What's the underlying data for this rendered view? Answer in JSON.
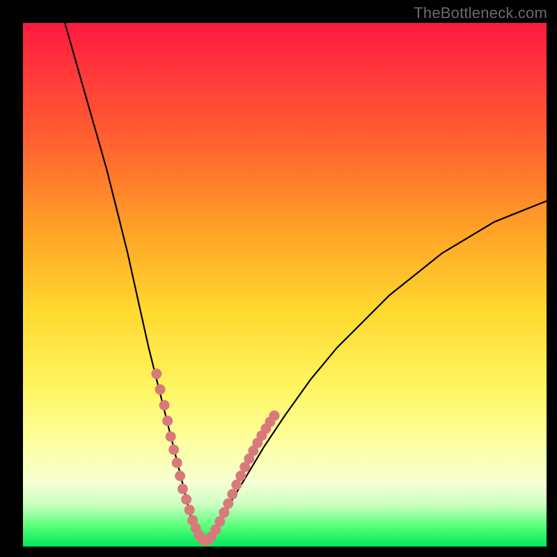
{
  "watermark": "TheBottleneck.com",
  "colors": {
    "background": "#000000",
    "curve": "#000000",
    "dots": "#d87a7a",
    "gradient_stops": [
      "#ff1a3e",
      "#ff3a3a",
      "#ff6a2e",
      "#ffa427",
      "#ffd92e",
      "#fff663",
      "#fdff9e",
      "#f6ffd4",
      "#caffc0",
      "#5bff7a",
      "#00e85c"
    ]
  },
  "chart_data": {
    "type": "line",
    "title": "",
    "xlabel": "",
    "ylabel": "",
    "xlim": [
      0,
      100
    ],
    "ylim": [
      0,
      100
    ],
    "series": [
      {
        "name": "bottleneck-curve",
        "x": [
          8,
          10,
          12,
          14,
          16,
          18,
          20,
          22,
          24,
          26,
          28,
          30,
          31,
          32,
          33,
          34,
          35,
          36,
          37,
          38,
          40,
          43,
          46,
          50,
          55,
          60,
          65,
          70,
          75,
          80,
          85,
          90,
          95,
          100
        ],
        "y": [
          100,
          93,
          86,
          79,
          72,
          64,
          56,
          47,
          38,
          30,
          22,
          14,
          10,
          6,
          3,
          1.5,
          1,
          1.5,
          3,
          5,
          9,
          14,
          19,
          25,
          32,
          38,
          43,
          48,
          52,
          56,
          59,
          62,
          64,
          66
        ]
      }
    ],
    "highlight_points": {
      "name": "highlight-dots",
      "x": [
        25.5,
        26.2,
        27.0,
        27.6,
        28.2,
        28.8,
        29.4,
        30.0,
        30.5,
        31.2,
        31.8,
        32.4,
        33.0,
        33.6,
        34.2,
        34.8,
        35.4,
        36.0,
        36.8,
        37.6,
        38.4,
        39.2,
        40.0,
        40.8,
        41.6,
        42.4,
        43.2,
        44.0,
        44.8,
        45.6,
        46.4,
        47.2,
        48.0
      ],
      "y": [
        33,
        30,
        27,
        24,
        21,
        18.5,
        16,
        13.5,
        11,
        9,
        7,
        5,
        3.5,
        2.2,
        1.5,
        1.1,
        1.3,
        1.9,
        3.2,
        4.8,
        6.5,
        8.2,
        10,
        11.8,
        13.5,
        15.2,
        16.8,
        18.3,
        19.8,
        21.2,
        22.5,
        23.8,
        25
      ]
    }
  }
}
